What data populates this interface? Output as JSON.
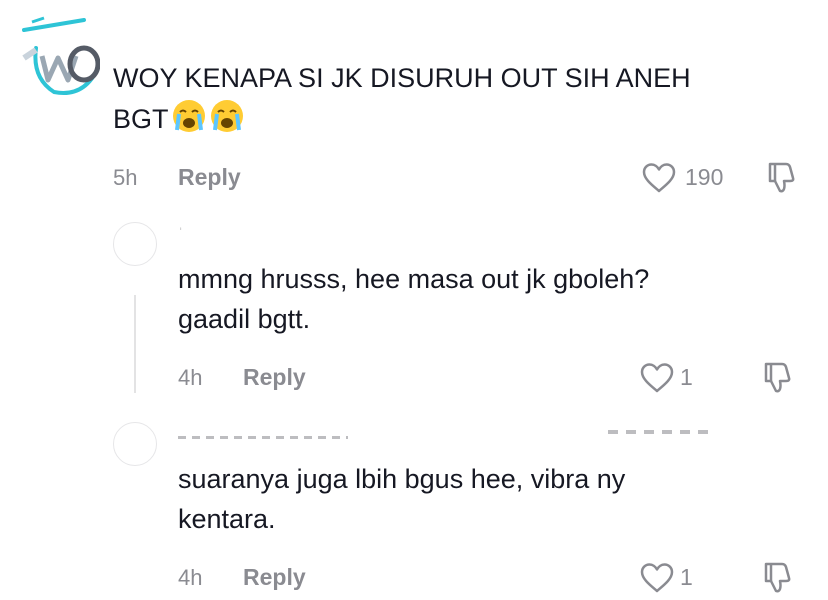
{
  "comment": {
    "text_line1": "WOY KENAPA SI JK DISURUH OUT SIH ANEH",
    "text_line2": "BGT",
    "emojis": [
      "loudly-crying-face-icon",
      "loudly-crying-face-icon"
    ],
    "time": "5h",
    "reply_label": "Reply",
    "likes": "190"
  },
  "replies": [
    {
      "text_line1": "mmng hrusss, hee masa out jk gboleh?",
      "text_line2": "gaadil bgtt.",
      "time": "4h",
      "reply_label": "Reply",
      "likes": "1"
    },
    {
      "text_line1": "suaranya juga lbih bgus hee, vibra ny",
      "text_line2": "kentara.",
      "time": "4h",
      "reply_label": "Reply",
      "likes": "1"
    }
  ],
  "colors": {
    "text": "#161823",
    "muted": "#8a8b91",
    "avatar_accent": "#2ec4d6"
  }
}
